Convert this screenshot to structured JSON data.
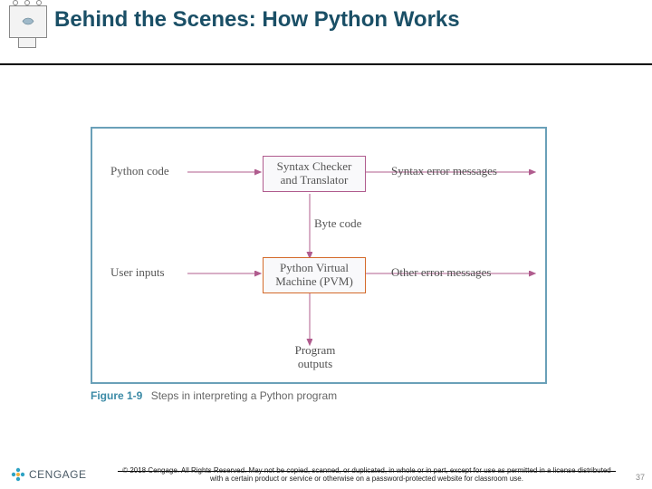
{
  "title": "Behind the Scenes: How Python Works",
  "diagram": {
    "inputs": {
      "code": "Python code",
      "user": "User inputs"
    },
    "boxes": {
      "checker": "Syntax Checker\nand Translator",
      "pvm": "Python Virtual\nMachine (PVM)"
    },
    "internal": {
      "bytecode": "Byte code"
    },
    "outputs": {
      "syntaxerr": "Syntax error messages",
      "othererr": "Other error messages",
      "program": "Program\noutputs"
    }
  },
  "caption": {
    "figno": "Figure 1-9",
    "text": "Steps in interpreting a Python program"
  },
  "footer": {
    "brand": "CENGAGE",
    "copy": "© 2018 Cengage. All Rights Reserved. May not be copied, scanned, or duplicated, in whole or in part, except for use as permitted in a license distributed with a certain product or service or otherwise on a password-protected website for classroom use.",
    "page": "37"
  }
}
